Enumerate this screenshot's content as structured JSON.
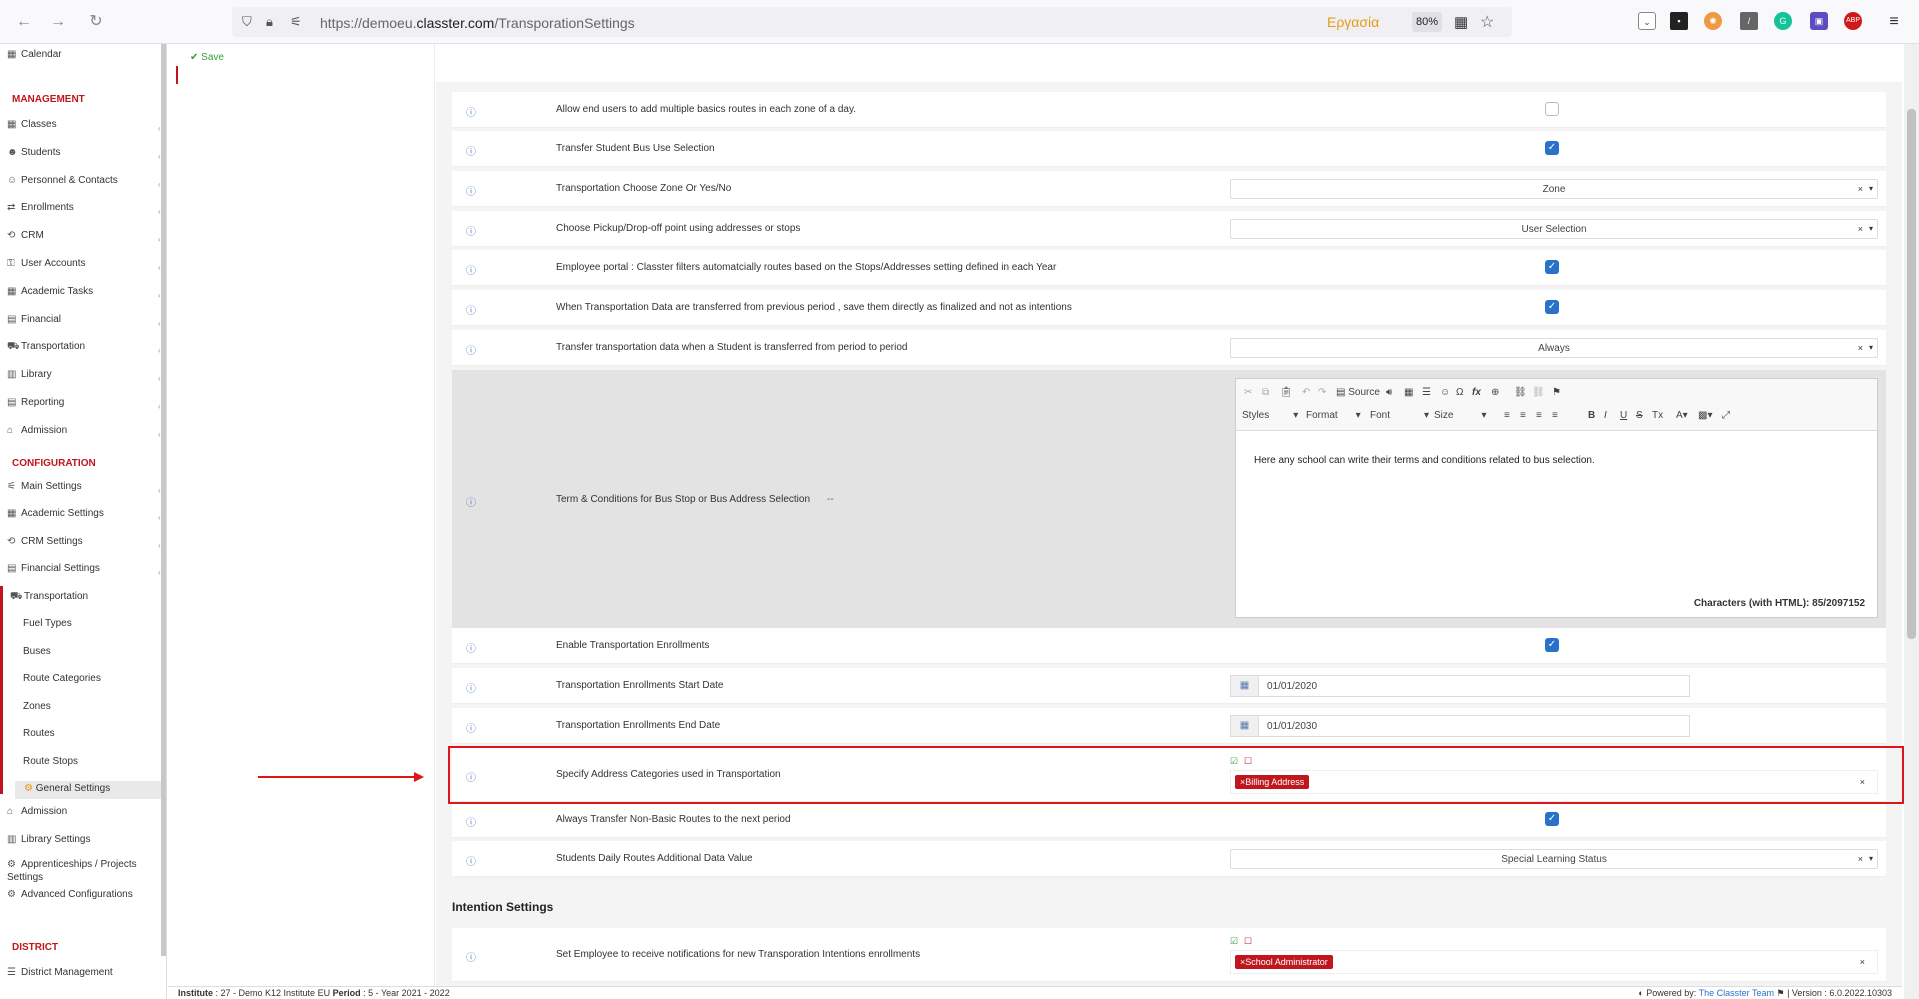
{
  "browser": {
    "url_prefix": "https://demoeu.",
    "url_domain": "classter.com",
    "url_path": "/TransporationSettings",
    "work_label": "Εργασία",
    "zoom": "80%"
  },
  "page": {
    "save_label": "Save"
  },
  "sidebar": {
    "top_items": [
      "Calendar"
    ],
    "management_header": "MANAGEMENT",
    "management_items": [
      "Classes",
      "Students",
      "Personnel & Contacts",
      "Enrollments",
      "CRM",
      "User Accounts",
      "Academic Tasks",
      "Financial",
      "Transportation",
      "Library",
      "Reporting",
      "Admission"
    ],
    "configuration_header": "CONFIGURATION",
    "configuration_items": [
      "Main Settings",
      "Academic Settings",
      "CRM Settings",
      "Financial Settings"
    ],
    "transportation_group": "Transportation",
    "transportation_subitems": [
      "Fuel Types",
      "Buses",
      "Route Categories",
      "Zones",
      "Routes",
      "Route Stops",
      "General Settings"
    ],
    "configuration_items_after": [
      "Admission",
      "Library Settings",
      "Apprenticeships / Projects Settings",
      "Advanced Configurations"
    ],
    "district_header": "DISTRICT",
    "district_items": [
      "District Management"
    ]
  },
  "settings": {
    "r1": "Allow end users to add multiple basics routes in each zone of a day.",
    "r2": "Transfer Student Bus Use Selection",
    "r3": "Transportation Choose Zone Or Yes/No",
    "r3_value": "Zone",
    "r4": "Choose Pickup/Drop-off point using addresses or stops",
    "r4_value": "User Selection",
    "r5": "Employee portal : Classter filters automatcially routes based on the Stops/Addresses setting defined in each Year",
    "r6": "When Transportation Data are transferred from previous period , save them directly as finalized and not as intentions",
    "r7": "Transfer transportation data when a Student is transferred from period to period",
    "r7_value": "Always",
    "r8": "Term & Conditions for Bus Stop or Bus Address Selection",
    "r8_dash": "--",
    "r8_editor_text": "Here any school can write their terms and conditions related to bus selection.",
    "r8_char_count": "Characters (with HTML): 85/2097152",
    "r9": "Enable Transportation Enrollments",
    "r10": "Transportation Enrollments Start Date",
    "r10_value": "01/01/2020",
    "r11": "Transportation Enrollments End Date",
    "r11_value": "01/01/2030",
    "r12": "Specify Address Categories used in Transportation",
    "r12_tag": "×Billing Address",
    "r13": "Always Transfer Non-Basic Routes to the next period",
    "r14": "Students Daily Routes Additional Data Value",
    "r14_value": "Special Learning Status",
    "intention_title": "Intention Settings",
    "r15": "Set Employee to receive notifications for new Transporation Intentions enrollments",
    "r15_tag": "×School Administrator"
  },
  "editor": {
    "source": "Source",
    "styles": "Styles",
    "format": "Format",
    "font": "Font",
    "size": "Size"
  },
  "footer": {
    "institute_label": "Institute",
    "institute_value": ": 27 - Demo K12 Institute EU",
    "period_label": "Period",
    "period_value": ": 5 - Year 2021 - 2022",
    "powered_by": "Powered by:",
    "team": "The Classter Team",
    "version": "| Version : 6.0.2022.10303"
  },
  "colors": {
    "accent": "#c0171f",
    "checkbox": "#2a72c9",
    "info": "#4a7bbd"
  },
  "icons": [
    "back-arrow-icon",
    "forward-arrow-icon",
    "reload-icon",
    "shield-icon",
    "lock-icon",
    "info-icon",
    "calendar-icon",
    "checkbox-checked-icon",
    "close-icon",
    "chevron-down-icon"
  ]
}
